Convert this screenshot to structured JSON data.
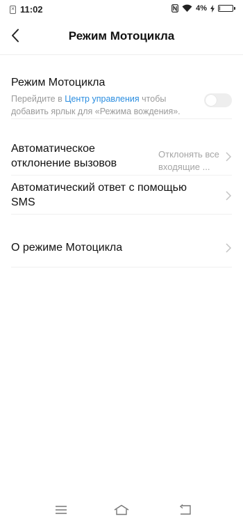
{
  "status_bar": {
    "time": "11:02",
    "battery_percent": "4%",
    "battery_level": 0.04,
    "icons": [
      "sim-icon",
      "nfc-icon",
      "wifi-icon",
      "charging-icon",
      "battery-icon"
    ]
  },
  "header": {
    "title": "Режим Мотоцикла",
    "back_icon": "back-arrow-icon"
  },
  "motorcycle_mode": {
    "title": "Режим Мотоцикла",
    "desc_prefix": "Перейдите в ",
    "desc_link": "Центр управления",
    "desc_suffix": " чтобы добавить ярлык для «Режима вождения».",
    "toggle_on": false
  },
  "auto_reject": {
    "title": "Автоматическое отклонение вызовов",
    "value": "Отклонять все входящие ..."
  },
  "auto_reply": {
    "title": "Автоматический ответ с помощью SMS"
  },
  "about": {
    "title": "О режиме Мотоцикла"
  },
  "colors": {
    "link": "#2a8de0",
    "secondary_text": "#9a9a9a",
    "toggle_off": "#eeeeee"
  },
  "nav_bar": {
    "icons": [
      "menu-icon",
      "home-icon",
      "back-icon"
    ]
  }
}
